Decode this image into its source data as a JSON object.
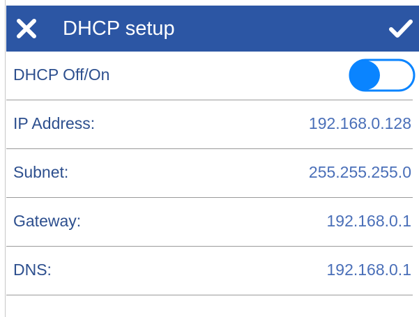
{
  "header": {
    "title": "DHCP setup",
    "close_icon": "close-icon",
    "confirm_icon": "checkmark-icon",
    "background_color": "#2c56a4"
  },
  "dhcp_toggle": {
    "label": "DHCP Off/On",
    "state": "off",
    "accent_color": "#0a84ff"
  },
  "fields": [
    {
      "label": "IP Address:",
      "value": "192.168.0.128"
    },
    {
      "label": "Subnet:",
      "value": "255.255.255.0"
    },
    {
      "label": "Gateway:",
      "value": "192.168.0.1"
    },
    {
      "label": "DNS:",
      "value": "192.168.0.1"
    }
  ],
  "colors": {
    "label_text": "#2d4f8e",
    "value_text": "#4a6fb8",
    "divider": "#9a9a9a"
  }
}
